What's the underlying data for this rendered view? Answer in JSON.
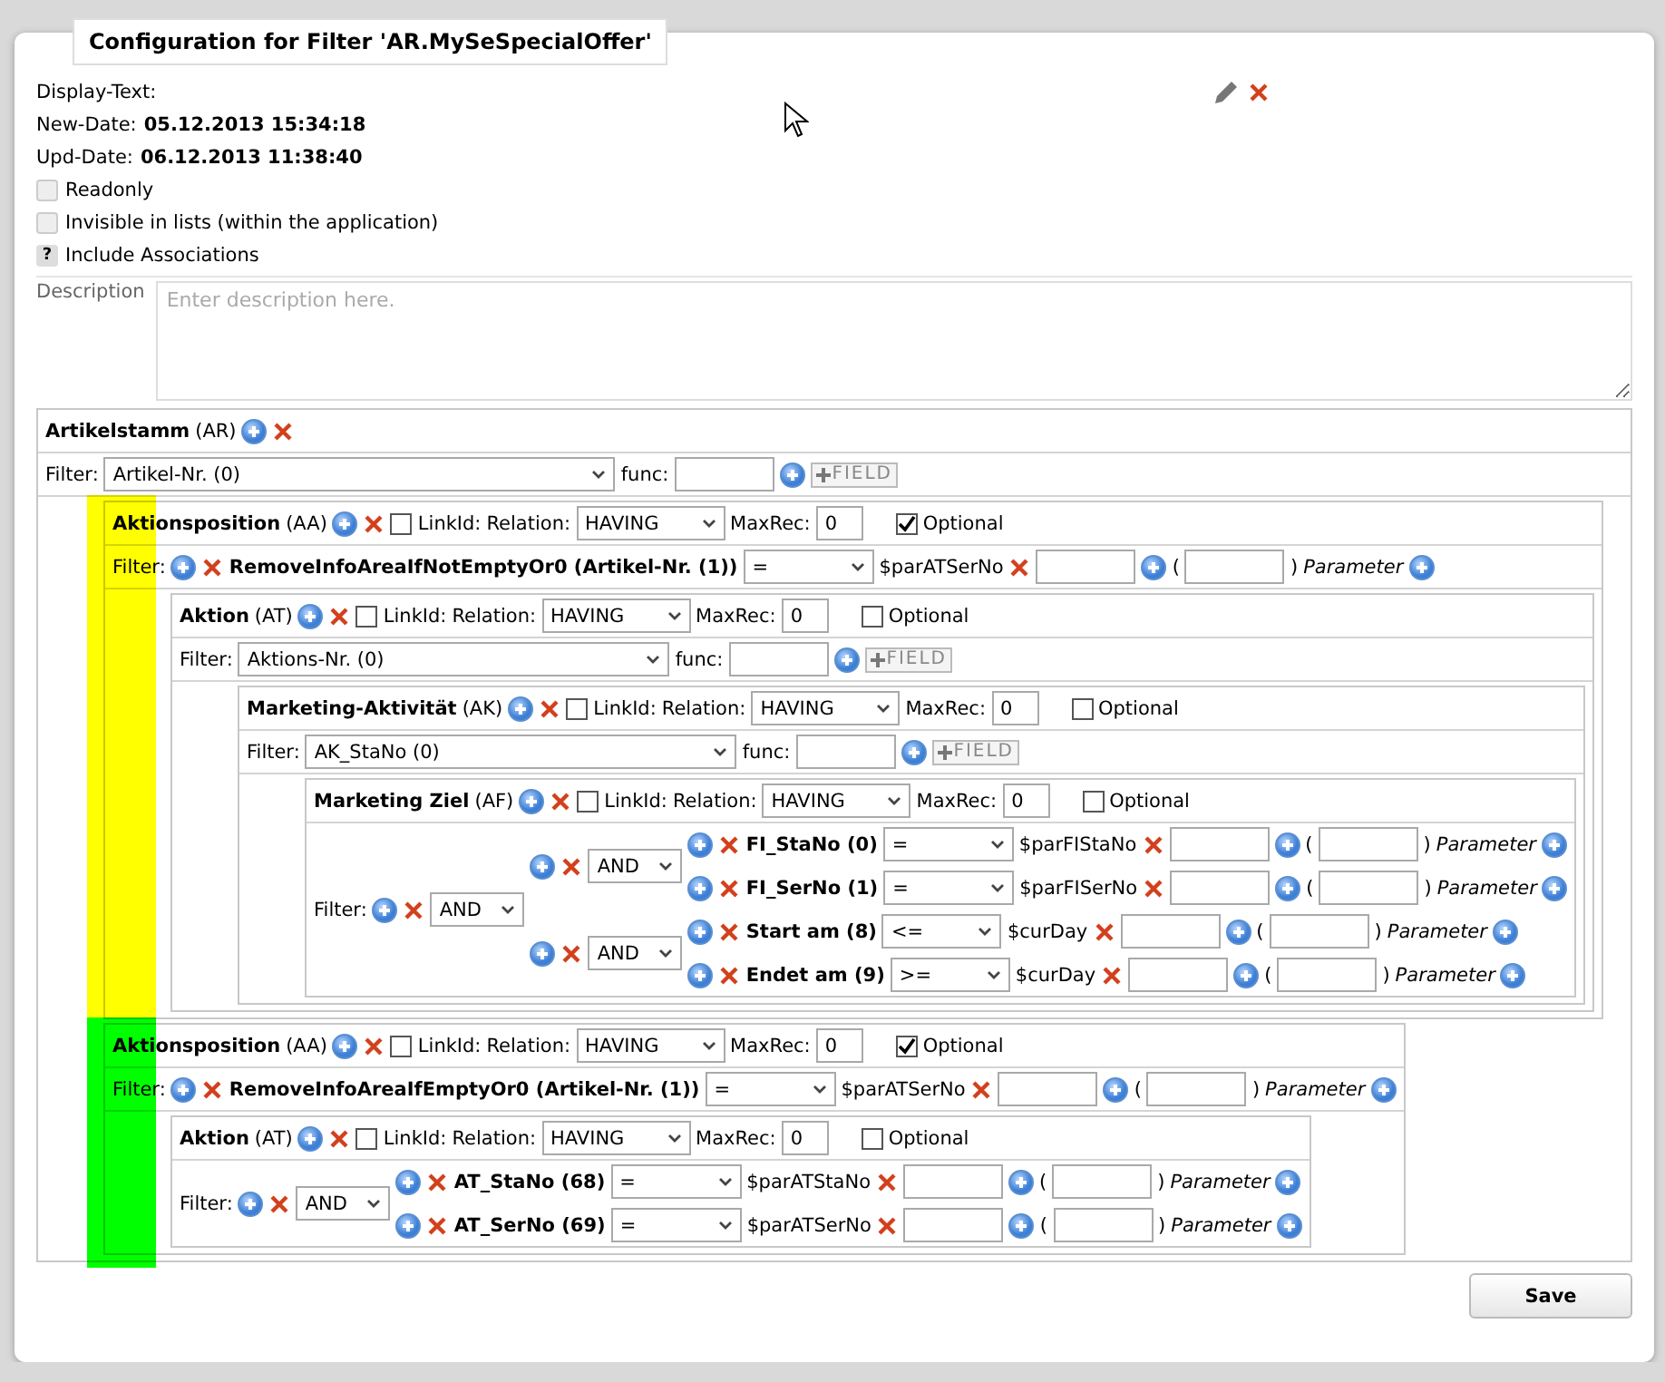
{
  "title": "Configuration for Filter 'AR.MySeSpecialOffer'",
  "display_text": {
    "label": "Display-Text:"
  },
  "dates": [
    {
      "label": "New-Date:",
      "value": "05.12.2013 15:34:18"
    },
    {
      "label": "Upd-Date:",
      "value": "06.12.2013 11:38:40"
    }
  ],
  "options": [
    {
      "kind": "checkbox",
      "label": "Readonly",
      "checked": false
    },
    {
      "kind": "checkbox",
      "label": "Invisible in lists (within the application)",
      "checked": false
    },
    {
      "kind": "help",
      "label": "Include Associations",
      "icon": "?"
    }
  ],
  "description": {
    "label": "Description",
    "placeholder": "Enter description here."
  },
  "root": {
    "kind": "root",
    "name": "Artikelstamm",
    "code": "(AR)",
    "filter": {
      "label": "Filter:",
      "expr": {
        "kind": "field",
        "value": "Artikel-Nr. (0)",
        "func_label": "func:",
        "add_field": "FIELD"
      }
    },
    "children": [
      {
        "kind": "link",
        "name": "Aktionsposition",
        "code": "(AA)",
        "color": "#ffff00",
        "link": {
          "linkid": {
            "label": "LinkId:",
            "checked": false
          },
          "relation": {
            "label": "Relation:",
            "value": "HAVING"
          },
          "maxrec": {
            "label": "MaxRec:",
            "value": "0"
          },
          "optional": {
            "label": "Optional",
            "checked": true
          }
        },
        "filter": {
          "label": "Filter:",
          "expr": {
            "kind": "condition",
            "field": "RemoveInfoAreaIfNotEmptyOr0 (Artikel-Nr. (1))",
            "operator": "=",
            "parameter": "$parATSerNo",
            "open": "(",
            "close": ")",
            "param_label": "Parameter"
          }
        },
        "children": [
          {
            "kind": "link",
            "name": "Aktion",
            "code": "(AT)",
            "link": {
              "linkid": {
                "label": "LinkId:",
                "checked": false
              },
              "relation": {
                "label": "Relation:",
                "value": "HAVING"
              },
              "maxrec": {
                "label": "MaxRec:",
                "value": "0"
              },
              "optional": {
                "label": "Optional",
                "checked": false
              }
            },
            "filter": {
              "label": "Filter:",
              "expr": {
                "kind": "field",
                "value": "Aktions-Nr. (0)",
                "func_label": "func:",
                "add_field": "FIELD"
              }
            },
            "children": [
              {
                "kind": "link",
                "name": "Marketing-Aktivität",
                "code": "(AK)",
                "link": {
                  "linkid": {
                    "label": "LinkId:",
                    "checked": false
                  },
                  "relation": {
                    "label": "Relation:",
                    "value": "HAVING"
                  },
                  "maxrec": {
                    "label": "MaxRec:",
                    "value": "0"
                  },
                  "optional": {
                    "label": "Optional",
                    "checked": false
                  }
                },
                "filter": {
                  "label": "Filter:",
                  "expr": {
                    "kind": "field",
                    "value": "AK_StaNo (0)",
                    "func_label": "func:",
                    "add_field": "FIELD"
                  }
                },
                "children": [
                  {
                    "kind": "link",
                    "name": "Marketing Ziel",
                    "code": "(AF)",
                    "link": {
                      "linkid": {
                        "label": "LinkId:",
                        "checked": false
                      },
                      "relation": {
                        "label": "Relation:",
                        "value": "HAVING"
                      },
                      "maxrec": {
                        "label": "MaxRec:",
                        "value": "0"
                      },
                      "optional": {
                        "label": "Optional",
                        "checked": false
                      }
                    },
                    "filter": {
                      "label": "Filter:",
                      "expr": {
                        "kind": "group",
                        "operator": "AND",
                        "items": [
                          {
                            "kind": "group",
                            "operator": "AND",
                            "items": [
                              {
                                "kind": "condition",
                                "field": "FI_StaNo (0)",
                                "operator": "=",
                                "parameter": "$parFIStaNo",
                                "open": "(",
                                "close": ")",
                                "param_label": "Parameter"
                              },
                              {
                                "kind": "condition",
                                "field": "FI_SerNo (1)",
                                "operator": "=",
                                "parameter": "$parFISerNo",
                                "open": "(",
                                "close": ")",
                                "param_label": "Parameter"
                              }
                            ]
                          },
                          {
                            "kind": "group",
                            "operator": "AND",
                            "items": [
                              {
                                "kind": "condition",
                                "field": "Start am (8)",
                                "operator": "<=",
                                "parameter": "$curDay",
                                "open": "(",
                                "close": ")",
                                "param_label": "Parameter"
                              },
                              {
                                "kind": "condition",
                                "field": "Endet am (9)",
                                "operator": ">=",
                                "parameter": "$curDay",
                                "open": "(",
                                "close": ")",
                                "param_label": "Parameter"
                              }
                            ]
                          }
                        ]
                      }
                    }
                  }
                ]
              }
            ]
          }
        ]
      },
      {
        "kind": "link",
        "name": "Aktionsposition",
        "code": "(AA)",
        "color": "#00ff00",
        "link": {
          "linkid": {
            "label": "LinkId:",
            "checked": false
          },
          "relation": {
            "label": "Relation:",
            "value": "HAVING"
          },
          "maxrec": {
            "label": "MaxRec:",
            "value": "0"
          },
          "optional": {
            "label": "Optional",
            "checked": true
          }
        },
        "filter": {
          "label": "Filter:",
          "expr": {
            "kind": "condition",
            "field": "RemoveInfoAreaIfEmptyOr0 (Artikel-Nr. (1))",
            "operator": "=",
            "parameter": "$parATSerNo",
            "open": "(",
            "close": ")",
            "param_label": "Parameter"
          }
        },
        "children": [
          {
            "kind": "link",
            "name": "Aktion",
            "code": "(AT)",
            "link": {
              "linkid": {
                "label": "LinkId:",
                "checked": false
              },
              "relation": {
                "label": "Relation:",
                "value": "HAVING"
              },
              "maxrec": {
                "label": "MaxRec:",
                "value": "0"
              },
              "optional": {
                "label": "Optional",
                "checked": false
              }
            },
            "filter": {
              "label": "Filter:",
              "expr": {
                "kind": "group",
                "operator": "AND",
                "items": [
                  {
                    "kind": "condition",
                    "field": "AT_StaNo (68)",
                    "operator": "=",
                    "parameter": "$parATStaNo",
                    "open": "(",
                    "close": ")",
                    "param_label": "Parameter"
                  },
                  {
                    "kind": "condition",
                    "field": "AT_SerNo (69)",
                    "operator": "=",
                    "parameter": "$parATSerNo",
                    "open": "(",
                    "close": ")",
                    "param_label": "Parameter"
                  }
                ]
              }
            }
          }
        ]
      }
    ]
  },
  "save": "Save"
}
